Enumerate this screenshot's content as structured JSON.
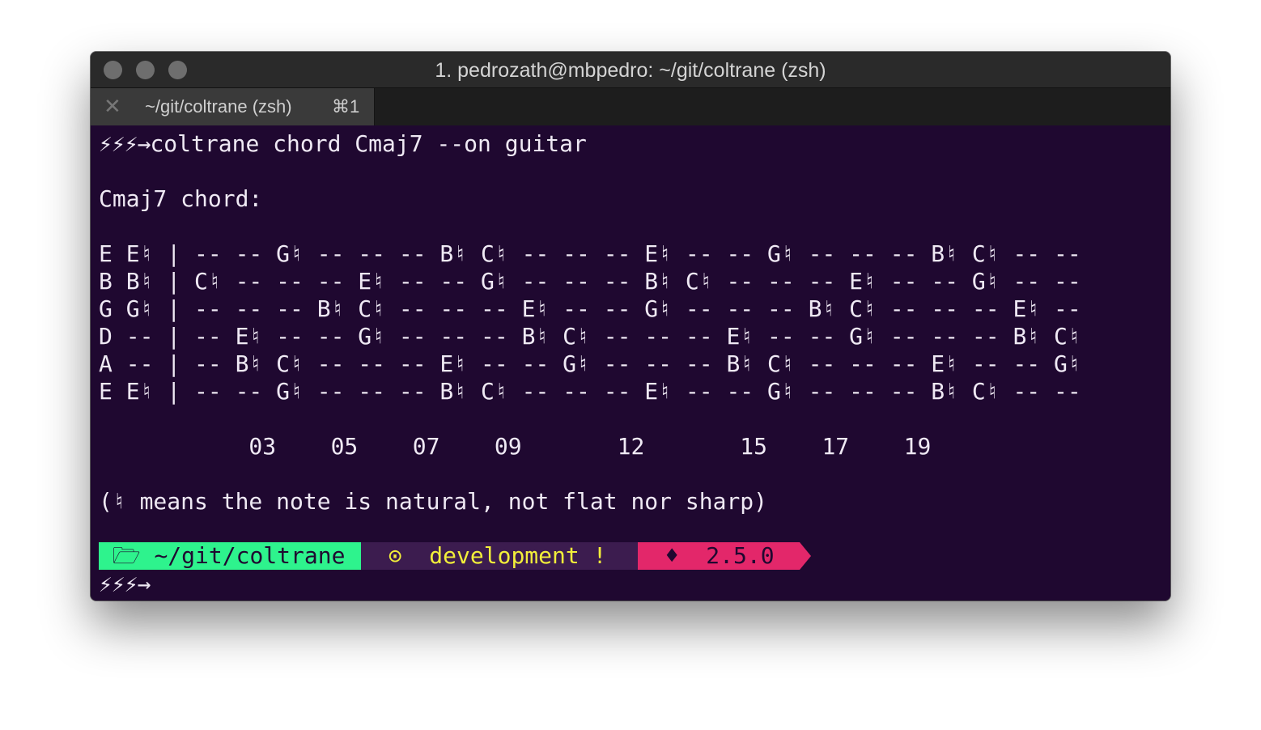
{
  "window": {
    "title": "1. pedrozath@mbpedro: ~/git/coltrane (zsh)"
  },
  "tab": {
    "close_glyph": "✕",
    "label": "~/git/coltrane (zsh)",
    "shortcut": "⌘1"
  },
  "terminal": {
    "prompt_symbol": "⚡⚡⚡→",
    "command": "coltrane chord Cmaj7 --on guitar",
    "chord_heading": "Cmaj7 chord:",
    "fretboard": [
      "E E♮ | -- -- G♮ -- -- -- B♮ C♮ -- -- -- E♮ -- -- G♮ -- -- -- B♮ C♮ -- --",
      "B B♮ | C♮ -- -- -- E♮ -- -- G♮ -- -- -- B♮ C♮ -- -- -- E♮ -- -- G♮ -- --",
      "G G♮ | -- -- -- B♮ C♮ -- -- -- E♮ -- -- G♮ -- -- -- B♮ C♮ -- -- -- E♮ --",
      "D -- | -- E♮ -- -- G♮ -- -- -- B♮ C♮ -- -- -- E♮ -- -- G♮ -- -- -- B♮ C♮",
      "A -- | -- B♮ C♮ -- -- -- E♮ -- -- G♮ -- -- -- B♮ C♮ -- -- -- E♮ -- -- G♮",
      "E E♮ | -- -- G♮ -- -- -- B♮ C♮ -- -- -- E♮ -- -- G♮ -- -- -- B♮ C♮ -- --"
    ],
    "fret_markers": "           03    05    07    09       12       15    17    19",
    "note_legend": "(♮ means the note is natural, not flat nor sharp)"
  },
  "statusline": {
    "dir_icon": "folder-open-icon",
    "dir_glyph": "🗁",
    "directory": "~/git/coltrane",
    "git_icon": "github-icon",
    "git_glyph": "⊙",
    "branch": "development",
    "dirty_glyph": "!",
    "ruby_icon": "ruby-gem-icon",
    "ruby_glyph": "♦",
    "ruby_version": "2.5.0",
    "colors": {
      "dir_bg": "#2ef38d",
      "git_bg": "#3c1c4f",
      "git_fg": "#f2ee3a",
      "ruby_bg": "#e3276a",
      "terminal_bg": "#1f0830"
    }
  }
}
